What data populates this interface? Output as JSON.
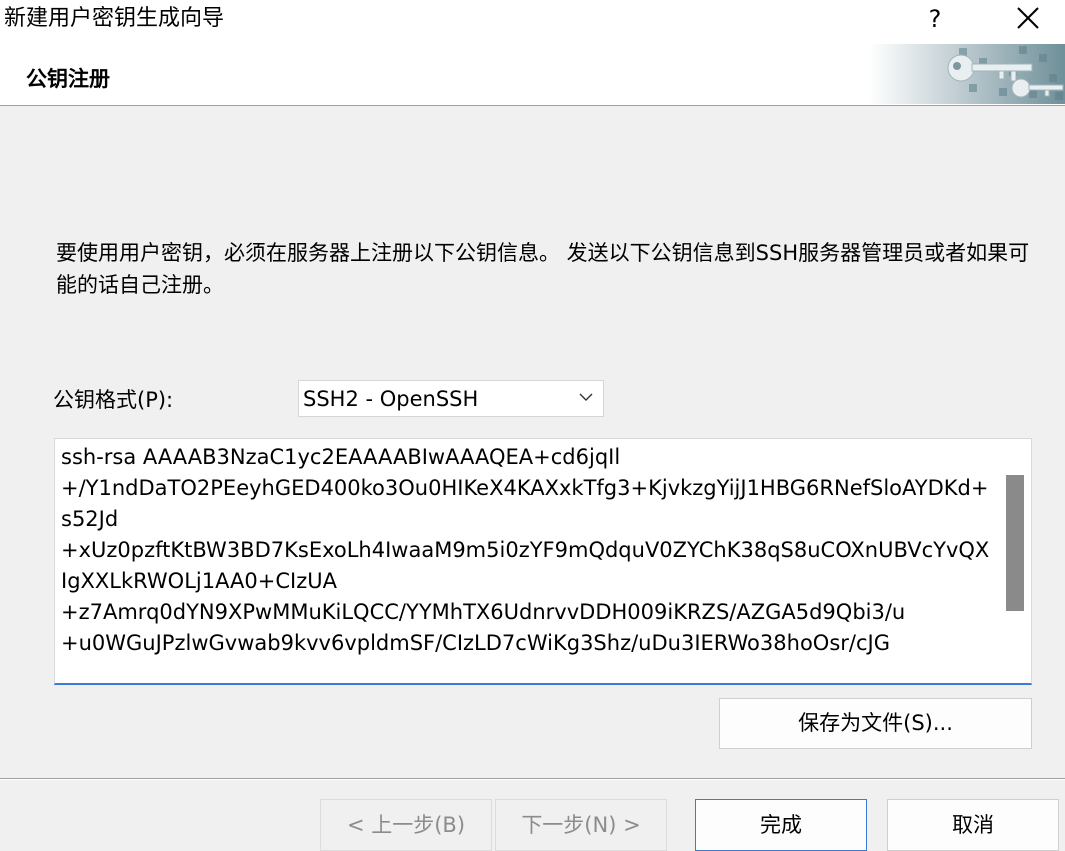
{
  "window": {
    "title": "新建用户密钥生成向导",
    "help_glyph": "?"
  },
  "header": {
    "page_title": "公钥注册"
  },
  "content": {
    "description": "要使用用户密钥，必须在服务器上注册以下公钥信息。 发送以下公钥信息到SSH服务器管理员或者如果可能的话自己注册。",
    "format_label": "公钥格式(P):",
    "format_value": "SSH2 - OpenSSH",
    "key_text": "ssh-rsa AAAAB3NzaC1yc2EAAAABIwAAAQEA+cd6jqIl\n+/Y1ndDaTO2PEeyhGED400ko3Ou0HIKeX4KAXxkTfg3+KjvkzgYijJ1HBG6RNefSloAYDKd+s52Jd\n+xUz0pzftKtBW3BD7KsExoLh4IwaaM9m5i0zYF9mQdquV0ZYChK38qS8uCOXnUBVcYvQXIgXXLkRWOLj1AA0+CIzUA\n+z7Amrq0dYN9XPwMMuKiLQCC/YYMhTX6UdnrvvDDH009iKRZS/AZGA5d9Qbi3/u\n+u0WGuJPzlwGvwab9kvv6vpldmSF/CIzLD7cWiKg3Shz/uDu3IERWo38hoOsr/cJG",
    "save_button": "保存为文件(S)..."
  },
  "footer": {
    "back_button": "< 上一步(B)",
    "next_button": "下一步(N) >",
    "finish_button": "完成",
    "cancel_button": "取消"
  }
}
